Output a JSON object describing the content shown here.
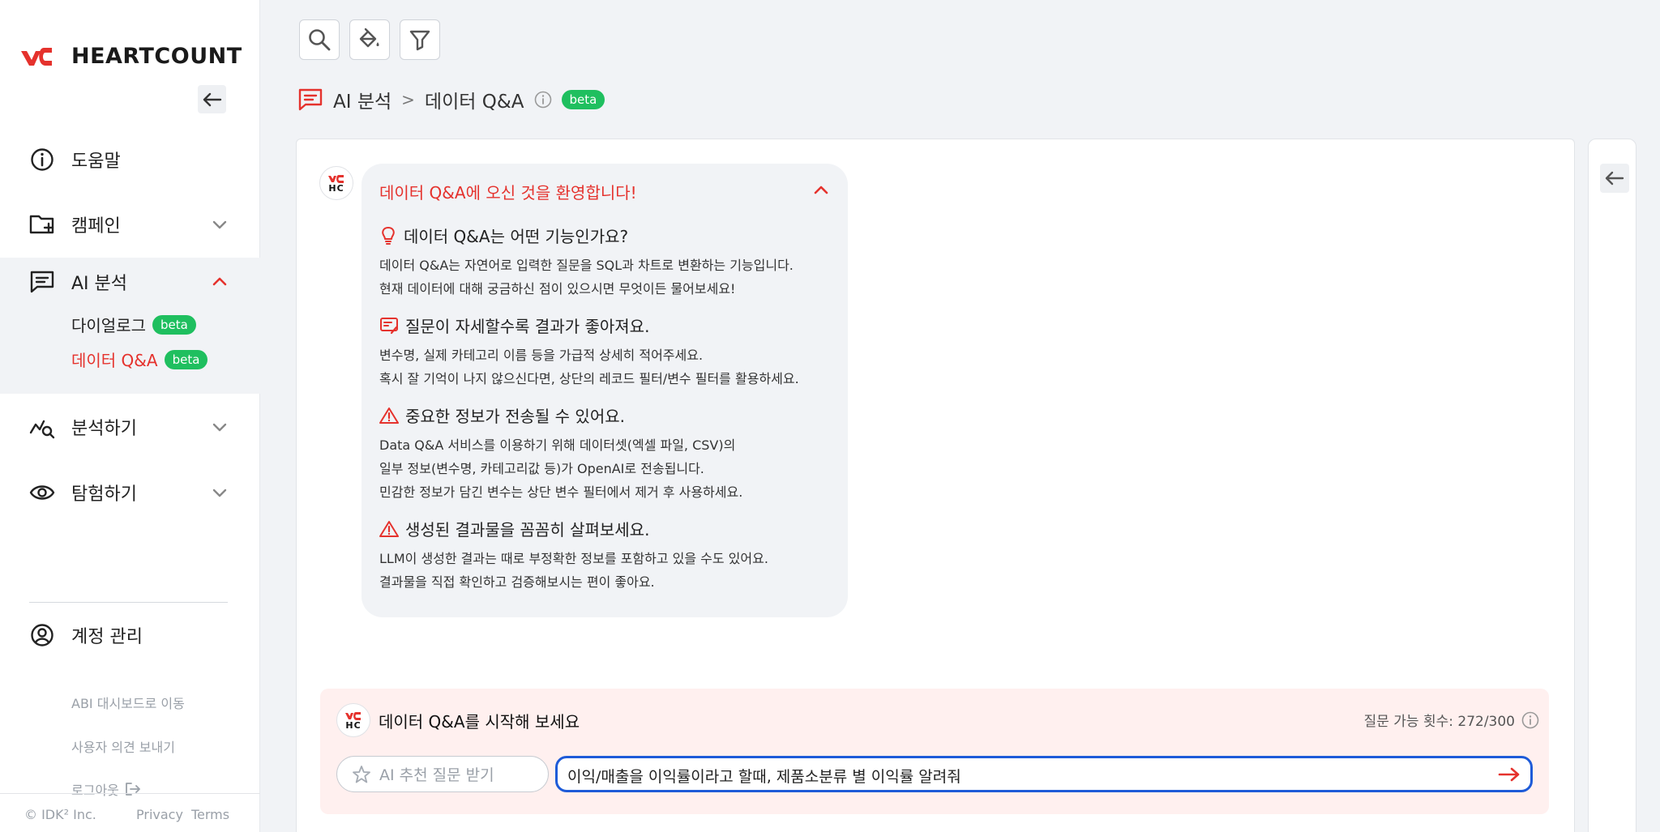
{
  "brand": {
    "name": "HEARTCOUNT",
    "accent": "#e5322d"
  },
  "sidebar": {
    "help_label": "도움말",
    "campaign_label": "캠페인",
    "ai_label": "AI 분석",
    "ai_sub": [
      {
        "label": "다이얼로그",
        "badge": "beta"
      },
      {
        "label": "데이터 Q&A",
        "badge": "beta"
      }
    ],
    "analyze_label": "분석하기",
    "explore_label": "탐험하기",
    "account_label": "계정 관리",
    "links": [
      "ABI 대시보드로 이동",
      "사용자 의견 보내기",
      "로그아웃"
    ],
    "footer": {
      "copyright": "© IDK² Inc.",
      "privacy": "Privacy",
      "terms": "Terms"
    }
  },
  "breadcrumb": {
    "section": "AI 분석",
    "separator": ">",
    "page": "데이터 Q&A",
    "badge": "beta"
  },
  "welcome": {
    "title": "데이터 Q&A에 오신 것을 환영합니다!",
    "sections": [
      {
        "heading": "데이터 Q&A는 어떤 기능인가요?",
        "lines": [
          "데이터 Q&A는 자연어로 입력한 질문을 SQL과 차트로 변환하는 기능입니다.",
          "현재 데이터에 대해 궁금하신 점이 있으시면 무엇이든 물어보세요!"
        ]
      },
      {
        "heading": "질문이 자세할수록 결과가 좋아져요.",
        "lines": [
          "변수명, 실제 카테고리 이름 등을 가급적 상세히 적어주세요.",
          "혹시 잘 기억이 나지 않으신다면, 상단의 레코드 필터/변수 필터를 활용하세요."
        ]
      },
      {
        "heading": "중요한 정보가 전송될 수 있어요.",
        "lines": [
          "Data Q&A 서비스를 이용하기 위해 데이터셋(엑셀 파일, CSV)의",
          "일부 정보(변수명, 카테고리값 등)가 OpenAI로 전송됩니다.",
          "민감한 정보가 담긴 변수는 상단 변수 필터에서 제거 후 사용하세요."
        ]
      },
      {
        "heading": "생성된 결과물을 꼼꼼히 살펴보세요.",
        "lines": [
          "LLM이 생성한 결과는 때로 부정확한 정보를 포함하고 있을 수도 있어요.",
          "결과물을 직접 확인하고 검증해보시는 편이 좋아요."
        ]
      }
    ]
  },
  "avatar": {
    "text": "HC"
  },
  "composer": {
    "title": "데이터 Q&A를 시작해 보세요",
    "quota": "질문 가능 횟수: 272/300",
    "suggest_label": "AI 추천 질문 받기",
    "input_value": "이익/매출을 이익률이라고 할때, 제품소분류 별 이익률 알려줘"
  }
}
